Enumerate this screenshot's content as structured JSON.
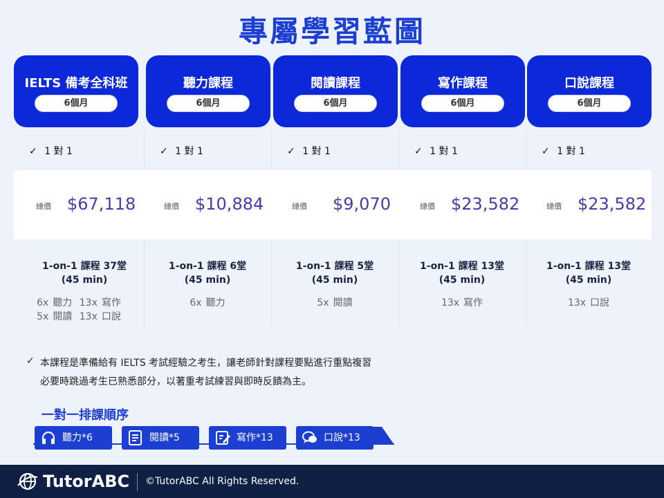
{
  "title": "專屬學習藍圖",
  "courses": [
    {
      "name": "IELTS 備考全科班",
      "duration": "6個月",
      "check": "1 對 1",
      "price_label": "總價",
      "price": "$67,118",
      "lessons": "1-on-1 課程 37堂",
      "lesson_length": "(45 min)",
      "breakdown": [
        [
          "6x",
          "聽力",
          "13x",
          "寫作"
        ],
        [
          "5x",
          "閱讀",
          "13x",
          "口說"
        ]
      ]
    },
    {
      "name": "聽力課程",
      "duration": "6個月",
      "check": "1 對 1",
      "price_label": "總價",
      "price": "$10,884",
      "lessons": "1-on-1 課程 6堂",
      "lesson_length": "(45 min)",
      "breakdown": [
        [
          "6x",
          "聽力"
        ]
      ]
    },
    {
      "name": "閱讀課程",
      "duration": "6個月",
      "check": "1 對 1",
      "price_label": "總價",
      "price": "$9,070",
      "lessons": "1-on-1 課程 5堂",
      "lesson_length": "(45 min)",
      "breakdown": [
        [
          "5x",
          "閱讀"
        ]
      ]
    },
    {
      "name": "寫作課程",
      "duration": "6個月",
      "check": "1 對 1",
      "price_label": "總價",
      "price": "$23,582",
      "lessons": "1-on-1 課程 13堂",
      "lesson_length": "(45 min)",
      "breakdown": [
        [
          "13x",
          "寫作"
        ]
      ]
    },
    {
      "name": "口說課程",
      "duration": "6個月",
      "check": "1 對 1",
      "price_label": "總價",
      "price": "$23,582",
      "lessons": "1-on-1 課程 13堂",
      "lesson_length": "(45 min)",
      "breakdown": [
        [
          "13x",
          "口說"
        ]
      ]
    }
  ],
  "note": {
    "line1": "本課程是準備給有 IELTS 考試經驗之考生，讓老師針對課程要點進行重點複習",
    "line2": "必要時跳過考生已熟悉部分，以著重考試練習與即時反饋為主。"
  },
  "sequence": {
    "title": "一對一排課順序",
    "steps": [
      {
        "label": "聽力*6",
        "icon": "headphones-icon"
      },
      {
        "label": "閱讀*5",
        "icon": "document-icon"
      },
      {
        "label": "寫作*13",
        "icon": "edit-icon"
      },
      {
        "label": "口說*13",
        "icon": "chat-bubbles-icon"
      }
    ]
  },
  "footer": {
    "brand": "TutorABC",
    "copyright": "©TutorABC All Rights Reserved."
  },
  "colors": {
    "primary": "#0d28d8",
    "title": "#1d3fd1",
    "price": "#4a3aa8",
    "background": "#eef2fa",
    "footer": "#0f2044"
  }
}
